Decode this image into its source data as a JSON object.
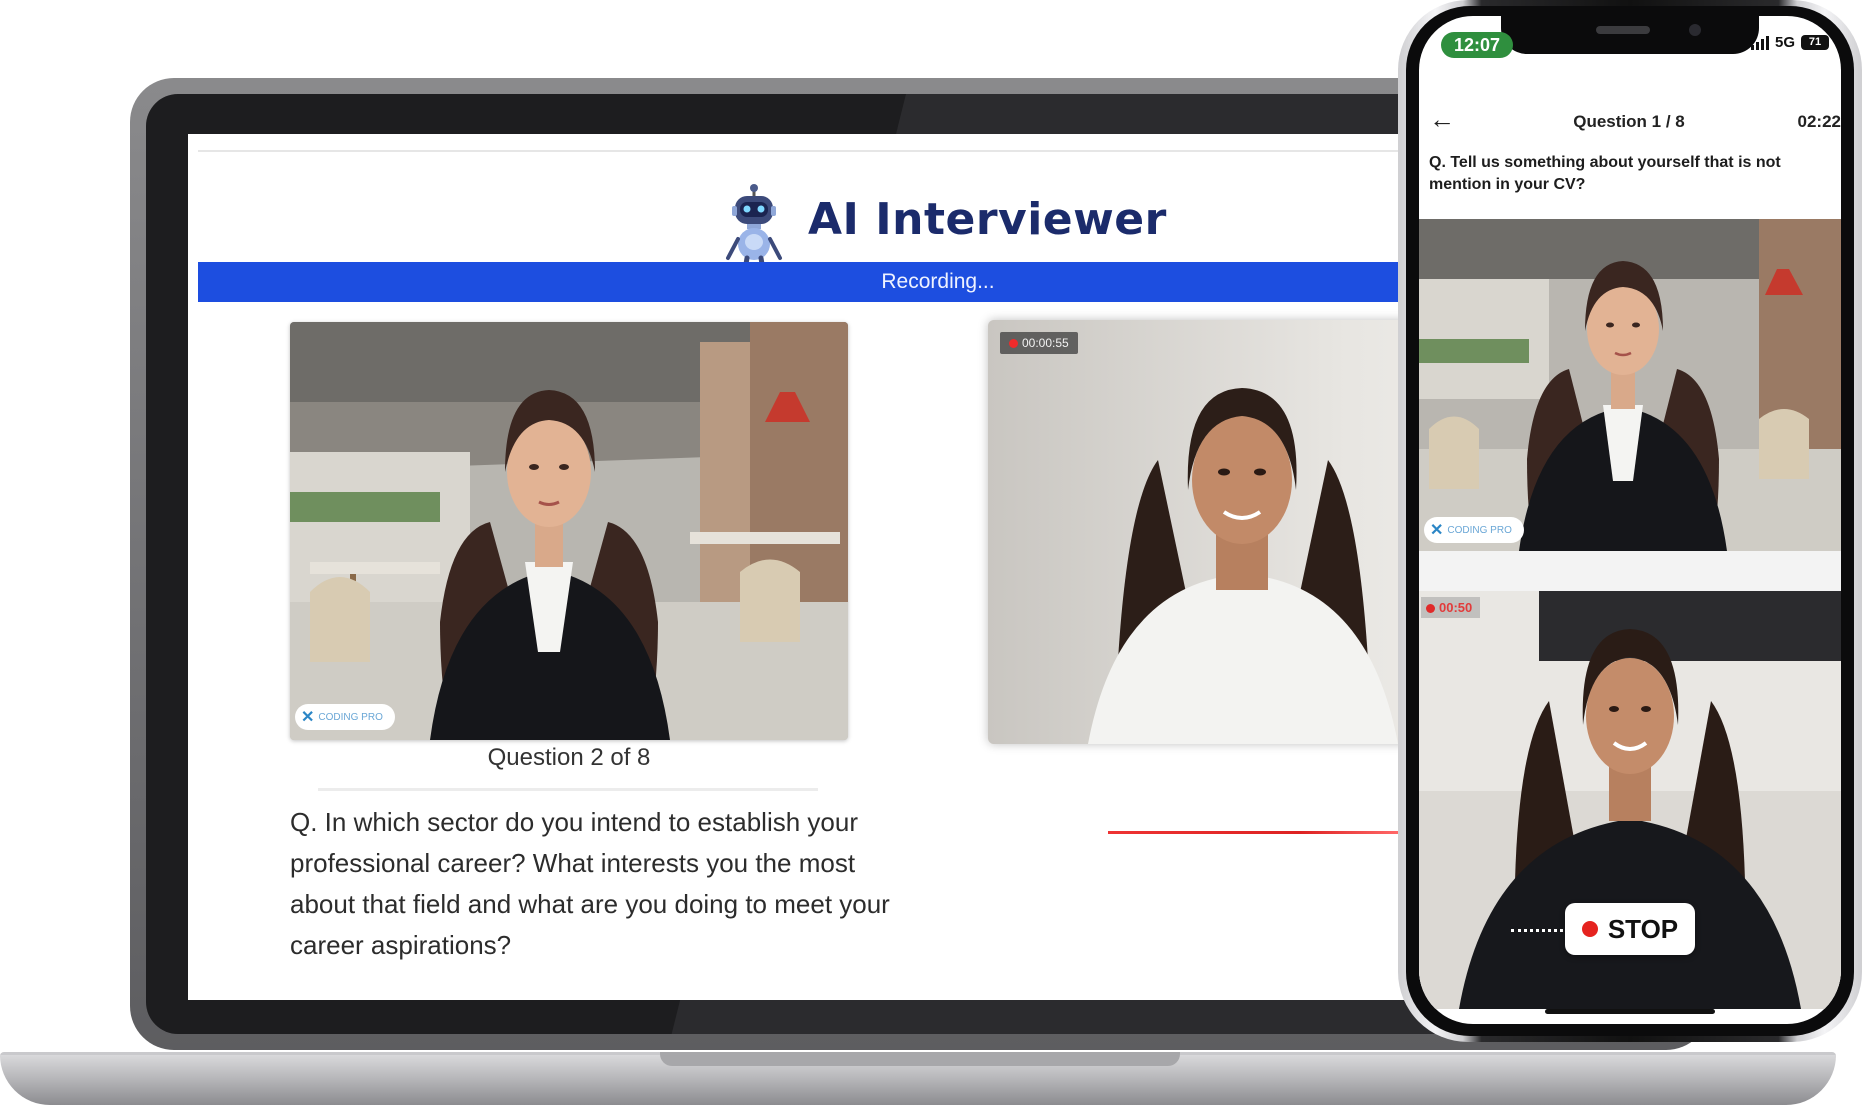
{
  "laptop": {
    "app_title": "AI Interviewer",
    "recording_label": "Recording...",
    "recording_timer": "00:00:55",
    "brand_label": "CODING PRO",
    "question_counter": "Question 2 of 8",
    "question_text": "Q. In which sector do you intend to establish your professional career? What interests you the most about that field and what are you doing to meet your career aspirations?"
  },
  "phone": {
    "status_time": "12:07",
    "network": "5G",
    "battery": "71",
    "question_counter": "Question 1 / 8",
    "timer": "02:22",
    "question_text": "Q. Tell us something about yourself that is not mention in your CV?",
    "brand_label": "CODING PRO",
    "recording_timer": "00:50",
    "stop_label": "STOP"
  },
  "colors": {
    "recording_bar": "#1d4ee0",
    "title": "#1b2b6b",
    "record_red": "#e5231f",
    "status_green": "#2f8f3e"
  },
  "icons": [
    "robot-icon",
    "back-arrow-icon",
    "record-dot-icon",
    "signal-icon",
    "battery-icon"
  ]
}
